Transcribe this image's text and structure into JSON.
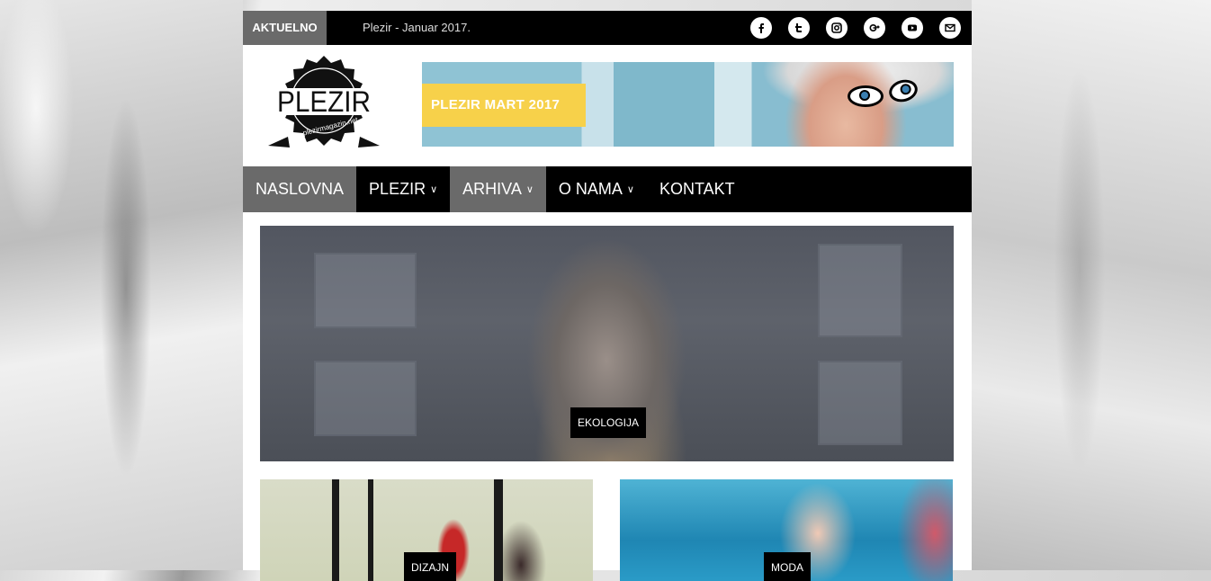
{
  "ticker": {
    "label": "AKTUELNO",
    "text": "Plezir - Januar 2017.",
    "socials": [
      "facebook-icon",
      "twitter-icon",
      "instagram-icon",
      "google-plus-icon",
      "youtube-icon",
      "email-icon"
    ]
  },
  "logo": {
    "brand": "PLEZIR",
    "url_text": "plezirmagazin.net"
  },
  "banner": {
    "label": "PLEZIR MART 2017"
  },
  "nav": {
    "items": [
      {
        "label": "NASLOVNA",
        "dropdown": false
      },
      {
        "label": "PLEZIR",
        "dropdown": true
      },
      {
        "label": "ARHIVA",
        "dropdown": true
      },
      {
        "label": "O NAMA",
        "dropdown": true
      },
      {
        "label": "KONTAKT",
        "dropdown": false
      }
    ]
  },
  "hero": {
    "category": "EKOLOGIJA"
  },
  "cards": [
    {
      "category": "DIZAJN"
    },
    {
      "category": "MODA"
    }
  ],
  "colors": {
    "nav_bg": "#000000",
    "active_gray": "#6a6a6a",
    "banner_yellow": "#f7d14a"
  }
}
